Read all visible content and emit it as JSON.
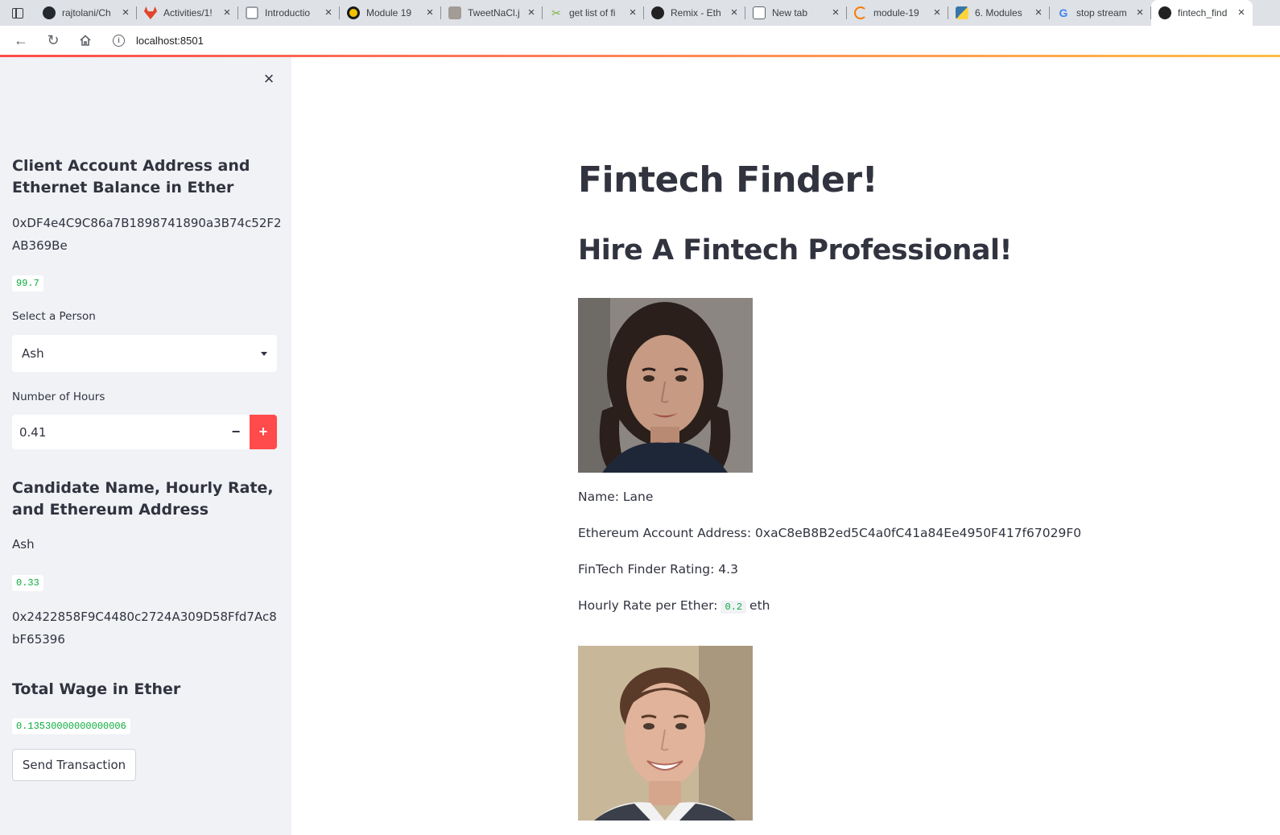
{
  "browser": {
    "tabs": [
      {
        "title": "rajtolani/Ch",
        "icon": "github-icon",
        "color": "#24292f"
      },
      {
        "title": "Activities/1!",
        "icon": "gitlab-icon",
        "color": "#e24329"
      },
      {
        "title": "Introductio",
        "icon": "document-icon",
        "color": "#9aa0a6"
      },
      {
        "title": "Module 19",
        "icon": "course-icon",
        "color": "#f2c200"
      },
      {
        "title": "TweetNaCl.j",
        "icon": "image-icon",
        "color": "#a39b95"
      },
      {
        "title": "get list of fi",
        "icon": "scissors-icon",
        "color": "#7cb342"
      },
      {
        "title": "Remix - Eth",
        "icon": "remix-icon",
        "color": "#222222"
      },
      {
        "title": "New tab",
        "icon": "newtab-icon",
        "color": "#5f6368"
      },
      {
        "title": "module-19",
        "icon": "loading-icon",
        "color": "#f57c00"
      },
      {
        "title": "6. Modules",
        "icon": "python-icon",
        "color": "#3776ab"
      },
      {
        "title": "stop stream",
        "icon": "google-icon",
        "color": "#4285f4"
      },
      {
        "title": "fintech_find",
        "icon": "streamlit-icon",
        "color": "#222222"
      }
    ],
    "url": "localhost:8501"
  },
  "sidebar": {
    "client_heading": "Client Account Address and Ethernet Balance in Ether",
    "client_address": "0xDF4e4C9C86a7B1898741890a3B74c52F2AB369Be",
    "client_balance": "99.7",
    "select_label": "Select a Person",
    "select_value": "Ash",
    "hours_label": "Number of Hours",
    "hours_value": "0.41",
    "candidate_heading": "Candidate Name, Hourly Rate, and Ethereum Address",
    "candidate_name": "Ash",
    "candidate_rate": "0.33",
    "candidate_address": "0x2422858F9C4480c2724A309D58Ffd7Ac8bF65396",
    "wage_heading": "Total Wage in Ether",
    "wage_value": "0.13530000000000006",
    "send_button": "Send Transaction"
  },
  "main": {
    "title": "Fintech Finder!",
    "subtitle": "Hire A Fintech Professional!",
    "candidates": [
      {
        "name_line": "Name: Lane",
        "address_line": "Ethereum Account Address: 0xaC8eB8B2ed5C4a0fC41a84Ee4950F417f67029F0",
        "rating_line": "FinTech Finder Rating: 4.3",
        "rate_prefix": "Hourly Rate per Ether:",
        "rate_value": "0.2",
        "rate_suffix": "eth"
      }
    ]
  },
  "colors": {
    "accent": "#ff4b4b",
    "sidebar_bg": "#f0f2f6",
    "code_green": "#09ab3b",
    "text": "#31333f"
  }
}
